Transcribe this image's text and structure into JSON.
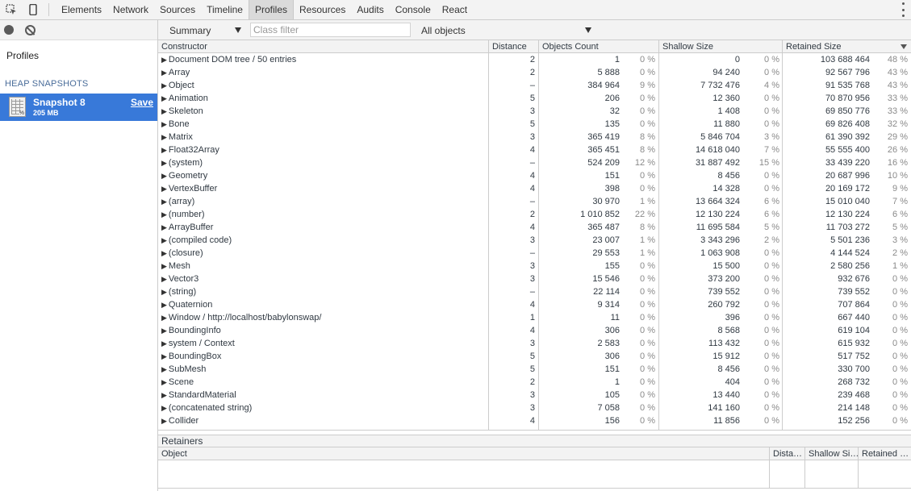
{
  "toolbar": {
    "tabs": [
      "Elements",
      "Network",
      "Sources",
      "Timeline",
      "Profiles",
      "Resources",
      "Audits",
      "Console",
      "React"
    ],
    "active_tab": "Profiles"
  },
  "sidebar": {
    "profiles_label": "Profiles",
    "heading": "HEAP SNAPSHOTS",
    "snapshot": {
      "title": "Snapshot 8",
      "size": "205 MB",
      "save": "Save"
    }
  },
  "main_toolbar": {
    "view": "Summary",
    "class_filter_placeholder": "Class filter",
    "objects_filter": "All objects"
  },
  "table": {
    "headers": {
      "constructor": "Constructor",
      "distance": "Distance",
      "count": "Objects Count",
      "shallow": "Shallow Size",
      "retained": "Retained Size"
    },
    "rows": [
      {
        "name": "Document DOM tree / 50 entries",
        "dist": "2",
        "count": "1",
        "count_pct": "0 %",
        "shallow": "0",
        "shallow_pct": "0 %",
        "retained": "103 688 464",
        "retained_pct": "48 %"
      },
      {
        "name": "Array",
        "dist": "2",
        "count": "5 888",
        "count_pct": "0 %",
        "shallow": "94 240",
        "shallow_pct": "0 %",
        "retained": "92 567 796",
        "retained_pct": "43 %"
      },
      {
        "name": "Object",
        "dist": "–",
        "count": "384 964",
        "count_pct": "9 %",
        "shallow": "7 732 476",
        "shallow_pct": "4 %",
        "retained": "91 535 768",
        "retained_pct": "43 %"
      },
      {
        "name": "Animation",
        "dist": "5",
        "count": "206",
        "count_pct": "0 %",
        "shallow": "12 360",
        "shallow_pct": "0 %",
        "retained": "70 870 956",
        "retained_pct": "33 %"
      },
      {
        "name": "Skeleton",
        "dist": "3",
        "count": "32",
        "count_pct": "0 %",
        "shallow": "1 408",
        "shallow_pct": "0 %",
        "retained": "69 850 776",
        "retained_pct": "33 %"
      },
      {
        "name": "Bone",
        "dist": "5",
        "count": "135",
        "count_pct": "0 %",
        "shallow": "11 880",
        "shallow_pct": "0 %",
        "retained": "69 826 408",
        "retained_pct": "32 %"
      },
      {
        "name": "Matrix",
        "dist": "3",
        "count": "365 419",
        "count_pct": "8 %",
        "shallow": "5 846 704",
        "shallow_pct": "3 %",
        "retained": "61 390 392",
        "retained_pct": "29 %"
      },
      {
        "name": "Float32Array",
        "dist": "4",
        "count": "365 451",
        "count_pct": "8 %",
        "shallow": "14 618 040",
        "shallow_pct": "7 %",
        "retained": "55 555 400",
        "retained_pct": "26 %"
      },
      {
        "name": "(system)",
        "dist": "–",
        "count": "524 209",
        "count_pct": "12 %",
        "shallow": "31 887 492",
        "shallow_pct": "15 %",
        "retained": "33 439 220",
        "retained_pct": "16 %"
      },
      {
        "name": "Geometry",
        "dist": "4",
        "count": "151",
        "count_pct": "0 %",
        "shallow": "8 456",
        "shallow_pct": "0 %",
        "retained": "20 687 996",
        "retained_pct": "10 %"
      },
      {
        "name": "VertexBuffer",
        "dist": "4",
        "count": "398",
        "count_pct": "0 %",
        "shallow": "14 328",
        "shallow_pct": "0 %",
        "retained": "20 169 172",
        "retained_pct": "9 %"
      },
      {
        "name": "(array)",
        "dist": "–",
        "count": "30 970",
        "count_pct": "1 %",
        "shallow": "13 664 324",
        "shallow_pct": "6 %",
        "retained": "15 010 040",
        "retained_pct": "7 %"
      },
      {
        "name": "(number)",
        "dist": "2",
        "count": "1 010 852",
        "count_pct": "22 %",
        "shallow": "12 130 224",
        "shallow_pct": "6 %",
        "retained": "12 130 224",
        "retained_pct": "6 %"
      },
      {
        "name": "ArrayBuffer",
        "dist": "4",
        "count": "365 487",
        "count_pct": "8 %",
        "shallow": "11 695 584",
        "shallow_pct": "5 %",
        "retained": "11 703 272",
        "retained_pct": "5 %"
      },
      {
        "name": "(compiled code)",
        "dist": "3",
        "count": "23 007",
        "count_pct": "1 %",
        "shallow": "3 343 296",
        "shallow_pct": "2 %",
        "retained": "5 501 236",
        "retained_pct": "3 %"
      },
      {
        "name": "(closure)",
        "dist": "–",
        "count": "29 553",
        "count_pct": "1 %",
        "shallow": "1 063 908",
        "shallow_pct": "0 %",
        "retained": "4 144 524",
        "retained_pct": "2 %"
      },
      {
        "name": "Mesh",
        "dist": "3",
        "count": "155",
        "count_pct": "0 %",
        "shallow": "15 500",
        "shallow_pct": "0 %",
        "retained": "2 580 256",
        "retained_pct": "1 %"
      },
      {
        "name": "Vector3",
        "dist": "3",
        "count": "15 546",
        "count_pct": "0 %",
        "shallow": "373 200",
        "shallow_pct": "0 %",
        "retained": "932 676",
        "retained_pct": "0 %"
      },
      {
        "name": "(string)",
        "dist": "–",
        "count": "22 114",
        "count_pct": "0 %",
        "shallow": "739 552",
        "shallow_pct": "0 %",
        "retained": "739 552",
        "retained_pct": "0 %"
      },
      {
        "name": "Quaternion",
        "dist": "4",
        "count": "9 314",
        "count_pct": "0 %",
        "shallow": "260 792",
        "shallow_pct": "0 %",
        "retained": "707 864",
        "retained_pct": "0 %"
      },
      {
        "name": "Window / http://localhost/babylonswap/",
        "dist": "1",
        "count": "11",
        "count_pct": "0 %",
        "shallow": "396",
        "shallow_pct": "0 %",
        "retained": "667 440",
        "retained_pct": "0 %"
      },
      {
        "name": "BoundingInfo",
        "dist": "4",
        "count": "306",
        "count_pct": "0 %",
        "shallow": "8 568",
        "shallow_pct": "0 %",
        "retained": "619 104",
        "retained_pct": "0 %"
      },
      {
        "name": "system / Context",
        "dist": "3",
        "count": "2 583",
        "count_pct": "0 %",
        "shallow": "113 432",
        "shallow_pct": "0 %",
        "retained": "615 932",
        "retained_pct": "0 %"
      },
      {
        "name": "BoundingBox",
        "dist": "5",
        "count": "306",
        "count_pct": "0 %",
        "shallow": "15 912",
        "shallow_pct": "0 %",
        "retained": "517 752",
        "retained_pct": "0 %"
      },
      {
        "name": "SubMesh",
        "dist": "5",
        "count": "151",
        "count_pct": "0 %",
        "shallow": "8 456",
        "shallow_pct": "0 %",
        "retained": "330 700",
        "retained_pct": "0 %"
      },
      {
        "name": "Scene",
        "dist": "2",
        "count": "1",
        "count_pct": "0 %",
        "shallow": "404",
        "shallow_pct": "0 %",
        "retained": "268 732",
        "retained_pct": "0 %"
      },
      {
        "name": "StandardMaterial",
        "dist": "3",
        "count": "105",
        "count_pct": "0 %",
        "shallow": "13 440",
        "shallow_pct": "0 %",
        "retained": "239 468",
        "retained_pct": "0 %"
      },
      {
        "name": "(concatenated string)",
        "dist": "3",
        "count": "7 058",
        "count_pct": "0 %",
        "shallow": "141 160",
        "shallow_pct": "0 %",
        "retained": "214 148",
        "retained_pct": "0 %"
      },
      {
        "name": "Collider",
        "dist": "4",
        "count": "156",
        "count_pct": "0 %",
        "shallow": "11 856",
        "shallow_pct": "0 %",
        "retained": "152 256",
        "retained_pct": "0 %"
      }
    ]
  },
  "retainers": {
    "title": "Retainers",
    "headers": {
      "object": "Object",
      "distance": "Dista…",
      "shallow": "Shallow Si…",
      "retained": "Retained …"
    }
  }
}
